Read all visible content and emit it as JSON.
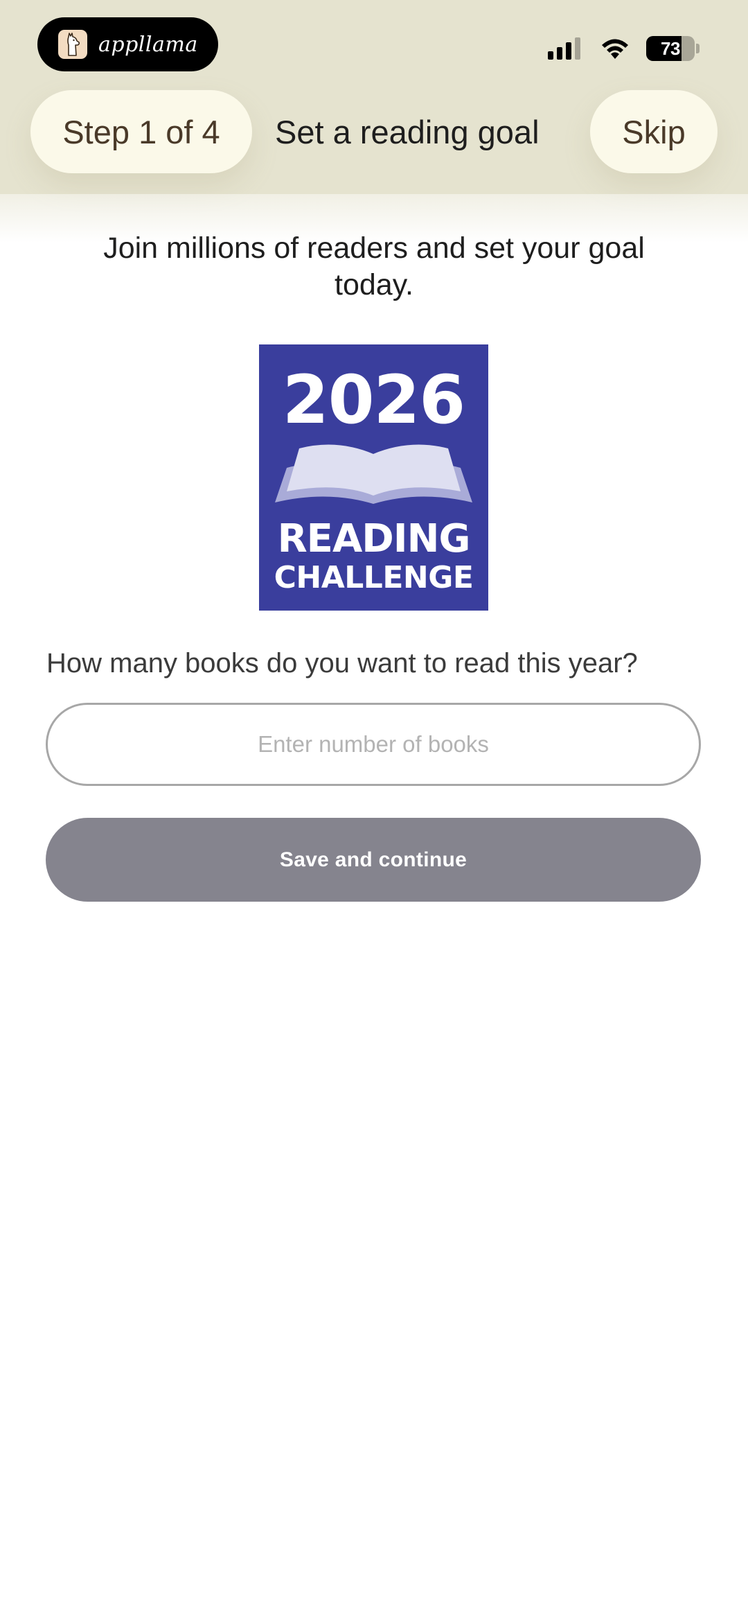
{
  "status_bar": {
    "app_name": "appllama",
    "app_icon": "llama-icon",
    "signal_icon": "cellular-signal-icon",
    "wifi_icon": "wifi-icon",
    "battery_level": "73"
  },
  "header": {
    "step_label": "Step 1 of 4",
    "title": "Set a reading goal",
    "skip_label": "Skip",
    "background_color": "#e5e3cf"
  },
  "main": {
    "intro_text": "Join millions of readers and set your goal today.",
    "badge": {
      "year": "2026",
      "line1": "READING",
      "line2": "CHALLENGE",
      "background_color": "#3a3e9d",
      "icon": "open-book-icon"
    },
    "question": "How many books do you want to read this year?",
    "books_input": {
      "value": "",
      "placeholder": "Enter number of books"
    },
    "save_label": "Save and continue",
    "save_button_color": "#85848e"
  }
}
